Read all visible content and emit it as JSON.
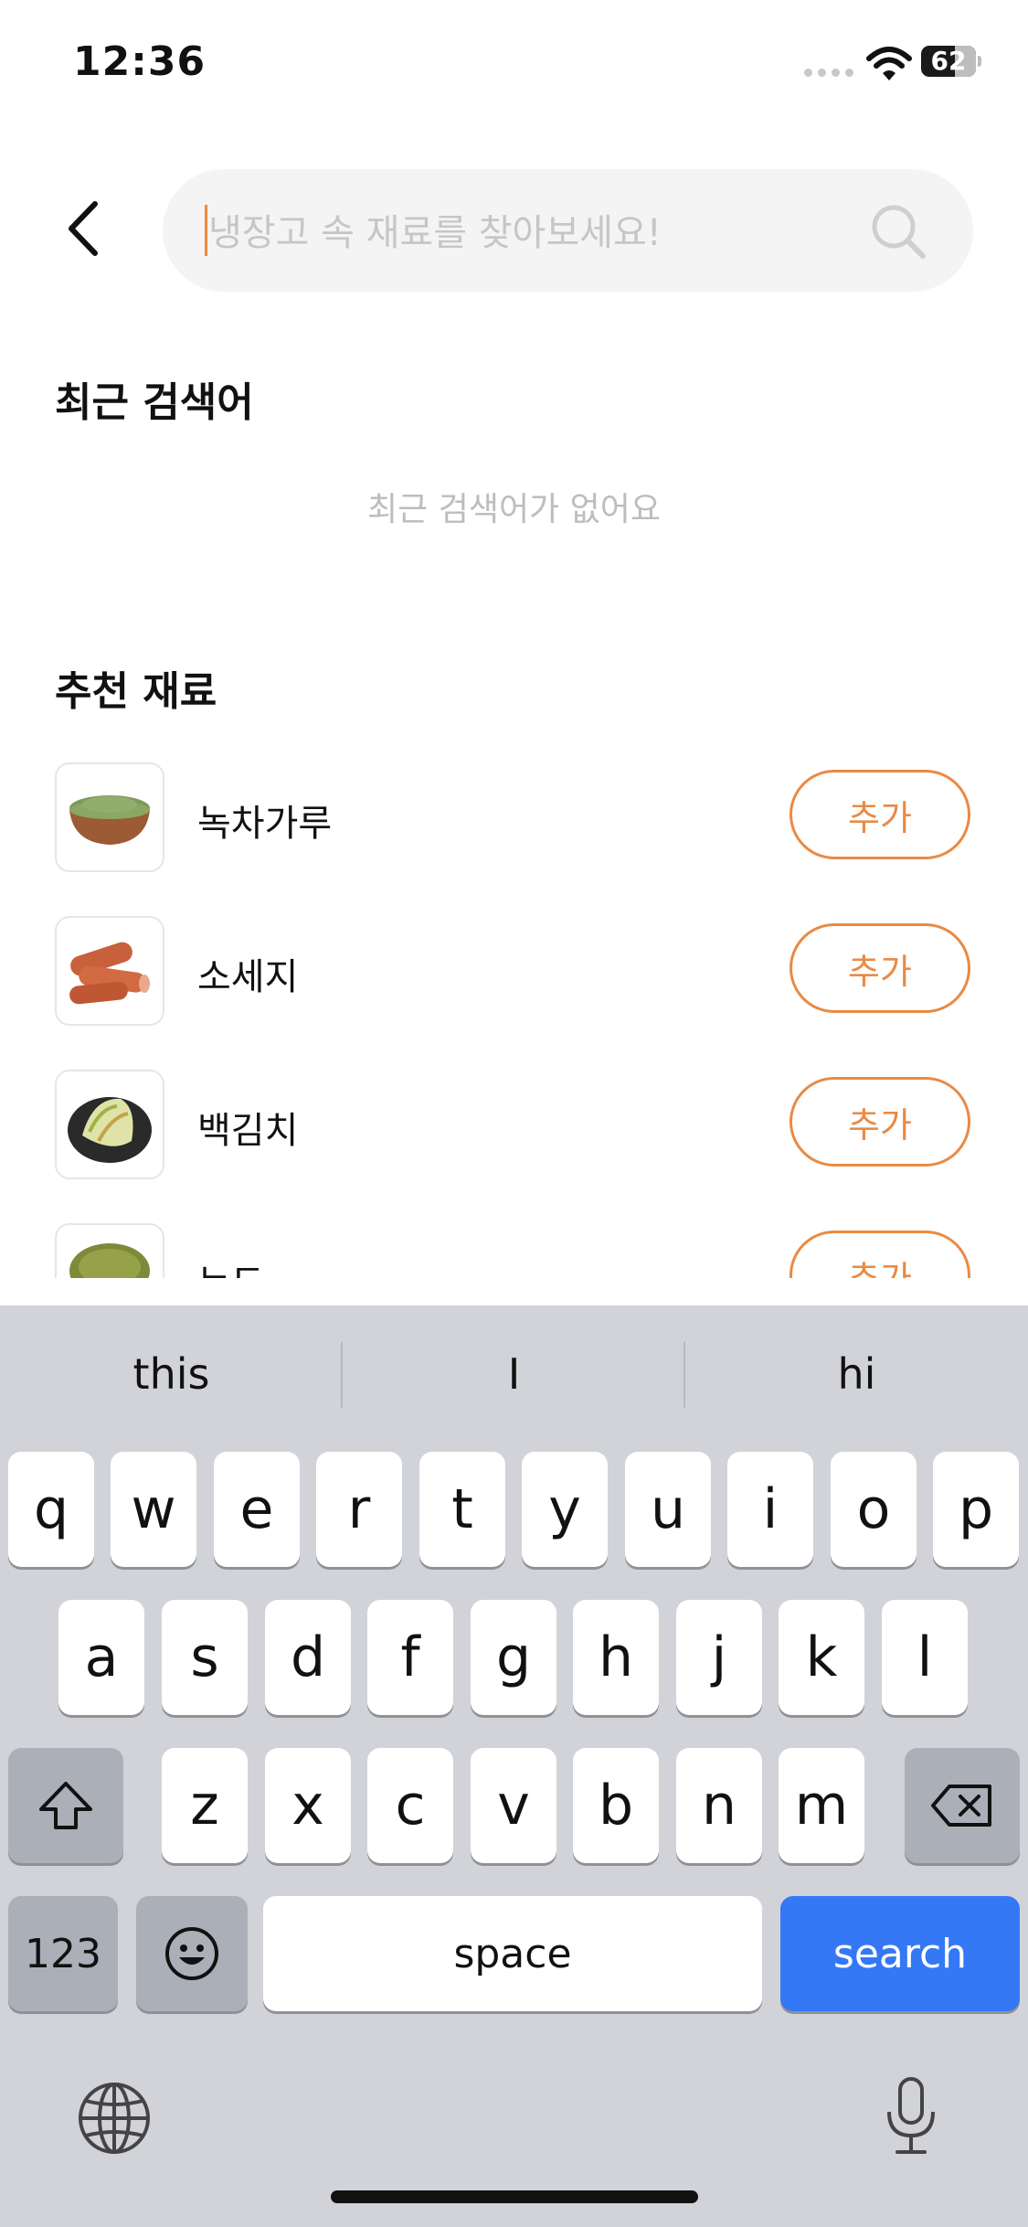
{
  "status_bar": {
    "time": "12:36",
    "battery": "62",
    "battery_level": 0.62
  },
  "search": {
    "placeholder": "냉장고 속 재료를 찾아보세요!"
  },
  "recent": {
    "title": "최근 검색어",
    "empty_message": "최근 검색어가 없어요"
  },
  "recommended": {
    "title": "추천 재료",
    "items": [
      {
        "name": "녹차가루",
        "button": "추가",
        "image": "green-tea-powder"
      },
      {
        "name": "소세지",
        "button": "추가",
        "image": "sausage"
      },
      {
        "name": "백김치",
        "button": "추가",
        "image": "white-kimchi"
      },
      {
        "name": "녹두",
        "button": "추가",
        "image": "mung-bean"
      }
    ]
  },
  "keyboard": {
    "suggestions": [
      "this",
      "I",
      "hi"
    ],
    "row1": [
      "q",
      "w",
      "e",
      "r",
      "t",
      "y",
      "u",
      "i",
      "o",
      "p"
    ],
    "row2": [
      "a",
      "s",
      "d",
      "f",
      "g",
      "h",
      "j",
      "k",
      "l"
    ],
    "row3": [
      "z",
      "x",
      "c",
      "v",
      "b",
      "n",
      "m"
    ],
    "numbers_key": "123",
    "space_key": "space",
    "search_key": "search",
    "accent_color": "#3478f6"
  },
  "colors": {
    "accent_orange": "#ea8a44"
  }
}
